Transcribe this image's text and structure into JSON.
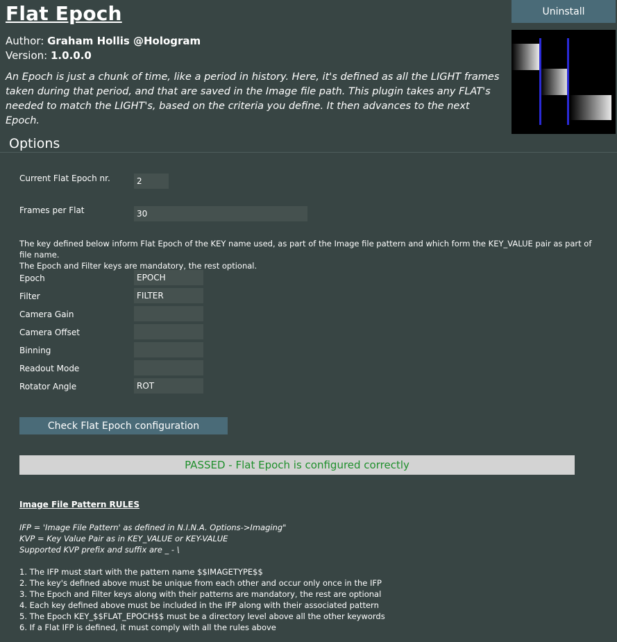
{
  "plugin": {
    "title": "Flat Epoch",
    "author_label": "Author:",
    "author_value": "Graham Hollis  @Hologram",
    "version_label": "Version:",
    "version_value": "1.0.0.0",
    "description": "An Epoch is just a chunk of time, like a period in history. Here, it's defined as all the LIGHT frames taken during that period, and that are saved in the Image file path. This plugin takes any FLAT's needed to match the LIGHT's, based on the criteria you define. It then advances to the next Epoch.",
    "uninstall_label": "Uninstall"
  },
  "options": {
    "header": "Options",
    "current_epoch_label": "Current Flat Epoch nr.",
    "current_epoch_value": "2",
    "frames_per_flat_label": "Frames per Flat",
    "frames_per_flat_value": "30",
    "keys_note": "The key defined below inform Flat Epoch of the KEY name used, as part of the Image file pattern and which form the KEY_VALUE pair as part of file name.",
    "keys_note2": "The Epoch and Filter keys are mandatory, the rest optional.",
    "keys": [
      {
        "label": "Epoch",
        "value": "EPOCH"
      },
      {
        "label": "Filter",
        "value": "FILTER"
      },
      {
        "label": "Camera Gain",
        "value": ""
      },
      {
        "label": "Camera Offset",
        "value": ""
      },
      {
        "label": "Binning",
        "value": ""
      },
      {
        "label": "Readout Mode",
        "value": ""
      },
      {
        "label": "Rotator Angle",
        "value": "ROT"
      }
    ],
    "check_button_label": "Check Flat Epoch configuration",
    "status_text": "PASSED - Flat Epoch is configured correctly"
  },
  "rules": {
    "title": "Image File Pattern RULES",
    "definitions": [
      "IFP = 'Image File Pattern' as defined in N.I.N.A. Options->Imaging\"",
      "KVP = Key Value Pair as in KEY_VALUE or KEY-VALUE",
      "Supported KVP prefix and suffix are _ - \\"
    ],
    "items": [
      "1. The IFP must start with the pattern name $$IMAGETYPE$$",
      "2. The key's defined above must be unique from each other and occur only once in the IFP",
      "3. The Epoch and Filter keys along with their patterns are mandatory, the rest are optional",
      "4. Each key defined above must be included in the IFP along with their associated pattern",
      "5. The Epoch KEY_$$FLAT_EPOCH$$ must be a directory level above all the other keywords",
      "6. If a Flat IFP is defined, it must comply with all the rules above"
    ]
  },
  "colors": {
    "background": "#384544",
    "button": "#4a6b78",
    "status_text": "#1e8f2b",
    "status_bg": "#d3d3d3"
  }
}
